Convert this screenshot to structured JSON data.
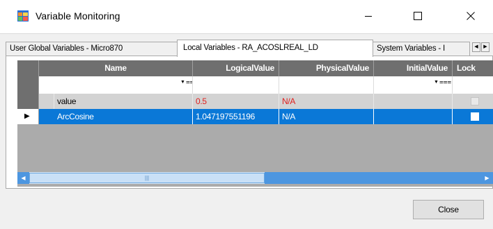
{
  "window": {
    "title": "Variable Monitoring",
    "app_icon": "windows-form-icon",
    "controls": {
      "minimize": "minimize-icon",
      "maximize": "maximize-icon",
      "close": "close-icon"
    }
  },
  "tabs": [
    {
      "label": "User Global Variables - Micro870",
      "active": false
    },
    {
      "label": "Local Variables - RA_ACOSLREAL_LD",
      "active": true
    },
    {
      "label": "System Variables - I",
      "active": false
    }
  ],
  "tab_scroll": {
    "left": "left-arrow-icon",
    "right": "right-arrow-icon"
  },
  "grid": {
    "columns": [
      "Name",
      "LogicalValue",
      "PhysicalValue",
      "InitialValue",
      "Lock"
    ],
    "filter_icons": [
      "dropdown-arrow-icon",
      "filter-icon"
    ],
    "rows": [
      {
        "name": "value",
        "logical": "0.5",
        "physical": "N/A",
        "initial": "",
        "lock": false,
        "selected": false
      },
      {
        "name": "ArcCosine",
        "logical": "1.047197551196",
        "physical": "N/A",
        "initial": "",
        "lock": false,
        "selected": true
      }
    ]
  },
  "scrollbar": {
    "grip": "scroll-grip-icon"
  },
  "buttons": {
    "close": "Close"
  },
  "colors": {
    "selection": "#0a78d7",
    "header": "#6f6f6f",
    "modified_value": "#e0201e"
  }
}
